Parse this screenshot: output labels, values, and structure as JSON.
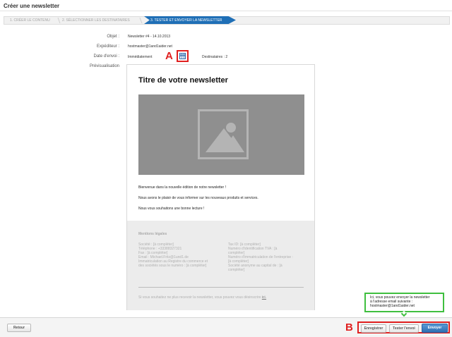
{
  "page": {
    "title": "Créer une newsletter"
  },
  "wizard": {
    "steps": [
      {
        "label": "1. CRÉER LE CONTENU"
      },
      {
        "label": "2. SÉLECTIONNER LES DESTINATAIRES"
      },
      {
        "label": "3. TESTER ET ENVOYER LA NEWSLETTER"
      }
    ],
    "active_step": 3,
    "active_color": "#1f6fb6"
  },
  "form": {
    "subject_label": "Objet :",
    "subject_value": "Newsletter #4 - 14.10.2013",
    "sender_label": "Expéditeur :",
    "sender_value": "hostmaster@1and1aider.net",
    "send_date_label": "Date d'envoi :",
    "send_date_value": "Immédiatement",
    "calendar_icon": "calendar-icon",
    "recipients_text": "Destinataires : 2",
    "preview_label": "Prévisualisation"
  },
  "annotations": {
    "marker_a": "A",
    "marker_b": "B",
    "highlight_color": "#e02020",
    "tooltip_color": "#3fbf3f"
  },
  "newsletter": {
    "title": "Titre de votre newsletter",
    "image_icon": "image-placeholder-icon",
    "paragraphs": [
      "Bienvenue dans la nouvelle édition de notre newsletter !",
      "Nous avons le plaisir de vous informer sur les nouveaux produits et services.",
      "Nous vous souhaitons une bonne lecture !"
    ],
    "legal": {
      "heading": "Mentions légales",
      "left": [
        "Société : [à compléter]",
        "Téléphone : +33388327321",
        "Fax : [à compléter]",
        "Email : Michael.Fritz@1und1.de",
        "Immatriculation au Registre du commerce et",
        "des sociétés sous le numéro : [à compléter]"
      ],
      "right": [
        "Tax ID: [à compléter]",
        "Numéro d'identification TVA : [à",
        "compléter]",
        "Numéro d'immatriculation de l'entreprise :",
        "[à compléter]",
        "Société anonyme au capital de : [à",
        "compléter]"
      ],
      "unsubscribe_text": "Si vous souhaitez ne plus recevoir la newsletter, vous pouvez vous désinscrire",
      "unsubscribe_link": "ici."
    }
  },
  "tooltip": {
    "lines": [
      "Ici, vous pouvez envoyer la newsletter",
      "à l'adresse email suivante :",
      "hostmaster@1and1aider.net"
    ]
  },
  "footer_bar": {
    "back_label": "Retour",
    "save_label": "Enregistrer",
    "test_label": "Tester l'envoi",
    "send_label": "Envoyer",
    "send_color": "#2f6fb2"
  }
}
